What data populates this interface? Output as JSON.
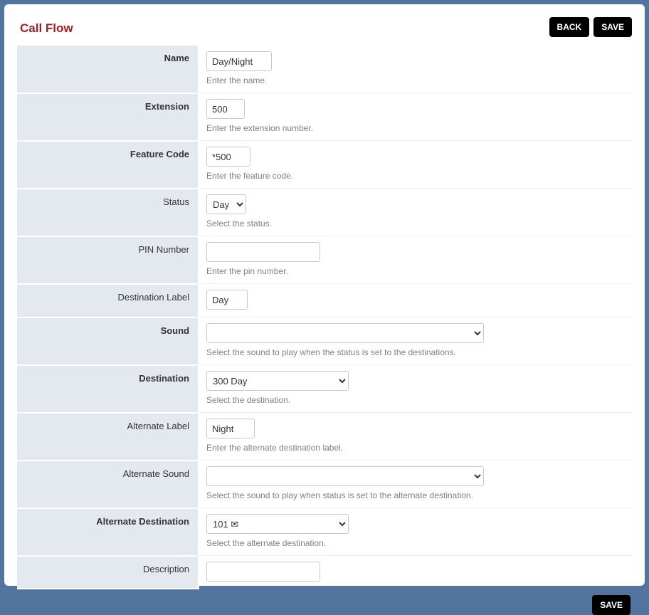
{
  "page": {
    "title": "Call Flow"
  },
  "buttons": {
    "back": "BACK",
    "save": "SAVE"
  },
  "form": {
    "name": {
      "label": "Name",
      "bold": true,
      "value": "Day/Night",
      "help": "Enter the name."
    },
    "extension": {
      "label": "Extension",
      "bold": true,
      "value": "500",
      "help": "Enter the extension number."
    },
    "feature_code": {
      "label": "Feature Code",
      "bold": true,
      "value": "*500",
      "help": "Enter the feature code."
    },
    "status": {
      "label": "Status",
      "bold": false,
      "selected": "Day",
      "help": "Select the status."
    },
    "pin": {
      "label": "PIN Number",
      "bold": false,
      "value": "",
      "help": "Enter the pin number."
    },
    "dest_label": {
      "label": "Destination Label",
      "bold": false,
      "value": "Day"
    },
    "sound": {
      "label": "Sound",
      "bold": true,
      "selected": "",
      "help": "Select the sound to play when the status is set to the destinations."
    },
    "destination": {
      "label": "Destination",
      "bold": true,
      "selected": "300 Day",
      "help": "Select the destination."
    },
    "alt_label": {
      "label": "Alternate Label",
      "bold": false,
      "value": "Night",
      "help": "Enter the alternate destination label."
    },
    "alt_sound": {
      "label": "Alternate Sound",
      "bold": false,
      "selected": "",
      "help": "Select the sound to play when status is set to the alternate destination."
    },
    "alt_destination": {
      "label": "Alternate Destination",
      "bold": true,
      "selected_prefix": "101",
      "icon": "✉",
      "help": "Select the alternate destination."
    },
    "description": {
      "label": "Description",
      "bold": false,
      "value": ""
    }
  }
}
